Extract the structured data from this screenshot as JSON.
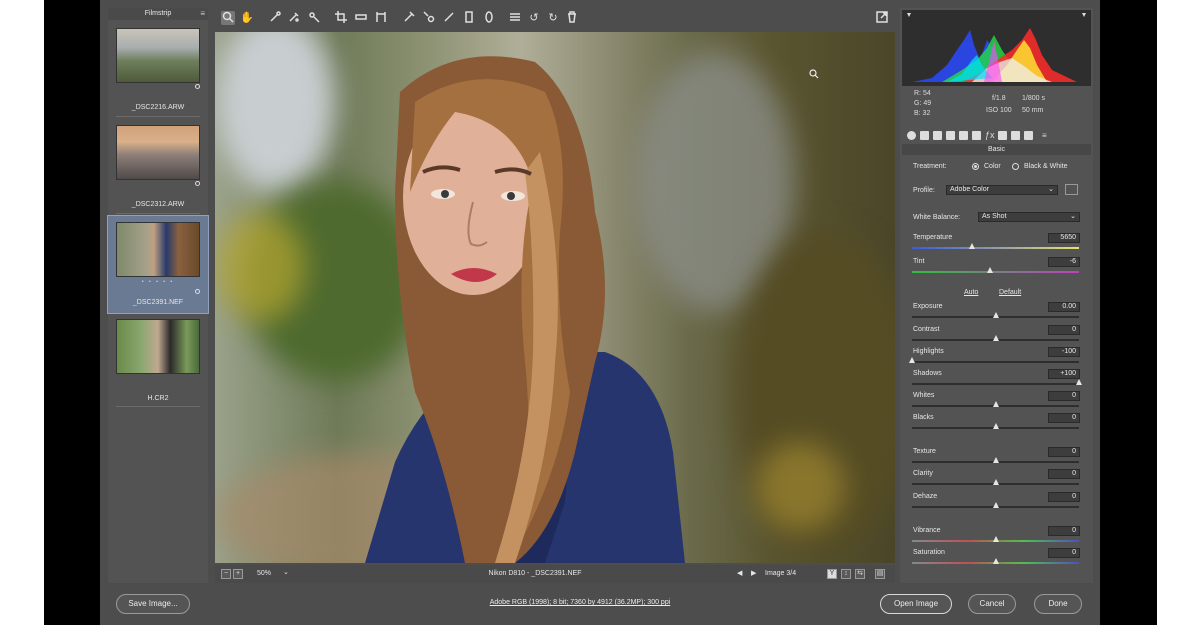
{
  "filmstrip": {
    "title": "Filmstrip",
    "items": [
      {
        "label": "_DSC2216.ARW",
        "selected": false
      },
      {
        "label": "_DSC2312.ARW",
        "selected": false
      },
      {
        "label": "_DSC2391.NEF",
        "selected": true,
        "stars": "• • • • •"
      },
      {
        "label": "H.CR2",
        "selected": false
      }
    ]
  },
  "toolbar": {
    "tools": [
      "zoom-tool",
      "hand-tool",
      "white-balance-tool",
      "color-sampler-tool",
      "targeted-adjustment-tool",
      "crop-tool",
      "straighten-tool",
      "transform-tool",
      "spot-removal-tool",
      "red-eye-tool",
      "adjustment-brush-tool",
      "graduated-filter-tool",
      "radial-filter-tool",
      "preferences-tool",
      "rotate-ccw-tool",
      "rotate-cw-tool",
      "trash-tool"
    ]
  },
  "status": {
    "zoom": "50%",
    "file": "Nikon D810  -  _DSC2391.NEF",
    "image_counter": "Image 3/4"
  },
  "info": {
    "r": "R:  54",
    "g": "G:  49",
    "b": "B:  32",
    "aperture": "f/1.8",
    "shutter": "1/800 s",
    "iso": "ISO 100",
    "focal": "50 mm"
  },
  "basic": {
    "title": "Basic",
    "treatment_label": "Treatment:",
    "treatment_color": "Color",
    "treatment_bw": "Black & White",
    "profile_label": "Profile:",
    "profile_value": "Adobe Color",
    "wb_label": "White Balance:",
    "wb_value": "As Shot",
    "auto": "Auto",
    "default": "Default",
    "sliders": [
      {
        "label": "Temperature",
        "value": "5650",
        "level": 0.36
      },
      {
        "label": "Tint",
        "value": "-6",
        "level": 0.47
      },
      {
        "label": "Exposure",
        "value": "0.00",
        "level": 0.5
      },
      {
        "label": "Contrast",
        "value": "0",
        "level": 0.5
      },
      {
        "label": "Highlights",
        "value": "-100",
        "level": 0.0
      },
      {
        "label": "Shadows",
        "value": "+100",
        "level": 1.0
      },
      {
        "label": "Whites",
        "value": "0",
        "level": 0.5
      },
      {
        "label": "Blacks",
        "value": "0",
        "level": 0.5
      },
      {
        "label": "Texture",
        "value": "0",
        "level": 0.5
      },
      {
        "label": "Clarity",
        "value": "0",
        "level": 0.5
      },
      {
        "label": "Dehaze",
        "value": "0",
        "level": 0.5
      },
      {
        "label": "Vibrance",
        "value": "0",
        "level": 0.5
      },
      {
        "label": "Saturation",
        "value": "0",
        "level": 0.5
      }
    ]
  },
  "bottom": {
    "save": "Save Image...",
    "workflow": "Adobe RGB (1998); 8 bit; 7360 by 4912 (36.2MP); 300 ppi",
    "open": "Open Image",
    "cancel": "Cancel",
    "done": "Done"
  },
  "colors": {
    "panel": "#535353",
    "background": "#4d4d4d",
    "selection": "#6b7a93"
  }
}
